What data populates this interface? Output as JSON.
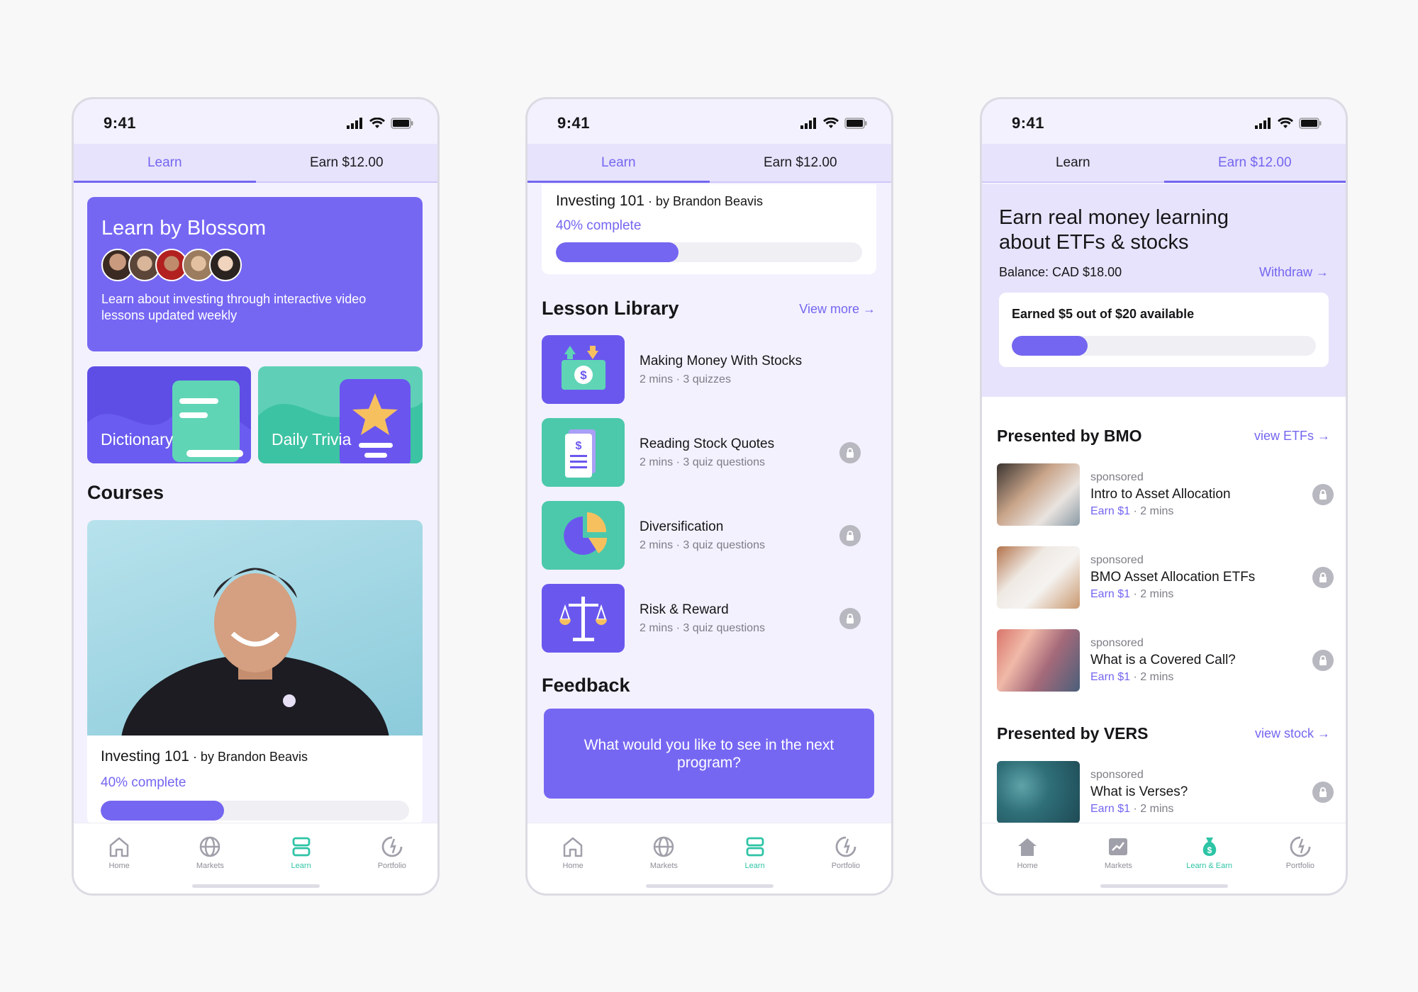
{
  "status_time": "9:41",
  "tabs": {
    "learn": "Learn",
    "earn": "Earn $12.00"
  },
  "nav": {
    "home": "Home",
    "markets": "Markets",
    "learn": "Learn",
    "portfolio": "Portfolio",
    "learn_earn": "Learn & Earn"
  },
  "phone1": {
    "hero_title": "Learn by Blossom",
    "hero_desc": "Learn about investing through interactive video lessons updated weekly",
    "tile_dictionary": "Dictionary",
    "tile_trivia": "Daily Trivia",
    "courses_heading": "Courses",
    "course_title": "Investing 101",
    "course_by": " · by Brandon Beavis",
    "course_progress_text": "40% complete",
    "course_progress": 0.4
  },
  "phone2": {
    "course_title": "Investing 101",
    "course_by": " · by Brandon Beavis",
    "course_progress_text": "40% complete",
    "lesson_heading": "Lesson Library",
    "view_more": "View more →",
    "lessons": [
      {
        "title": "Making Money With Stocks",
        "meta": "2 mins · 3 quizzes",
        "locked": false
      },
      {
        "title": "Reading Stock Quotes",
        "meta": "2 mins · 3 quiz questions",
        "locked": true
      },
      {
        "title": "Diversification",
        "meta": "2 mins · 3 quiz questions",
        "locked": true
      },
      {
        "title": "Risk & Reward",
        "meta": "2 mins · 3 quiz questions",
        "locked": true
      }
    ],
    "feedback_heading": "Feedback",
    "feedback_prompt": "What would you like to see in the next program?"
  },
  "phone3": {
    "heading": "Earn real money learning about ETFs & stocks",
    "balance": "Balance: CAD $18.00",
    "withdraw": "Withdraw →",
    "earned_text": "Earned $5 out of $20 available",
    "earned_progress": 0.25,
    "section1_heading": "Presented by BMO",
    "section1_link": "view ETFs →",
    "section2_heading": "Presented by VERS",
    "section2_link": "view stock →",
    "sponsored_label": "sponsored",
    "earn_label": "Earn $1",
    "duration": " · 2 mins",
    "items": [
      {
        "title": "Intro to Asset Allocation"
      },
      {
        "title": "BMO Asset Allocation ETFs"
      },
      {
        "title": "What is a Covered Call?"
      },
      {
        "title": "What is Verses?"
      }
    ]
  },
  "colors": {
    "accent": "#7466f0",
    "teal": "#2ec4a6",
    "bg": "#f3f1fe"
  }
}
